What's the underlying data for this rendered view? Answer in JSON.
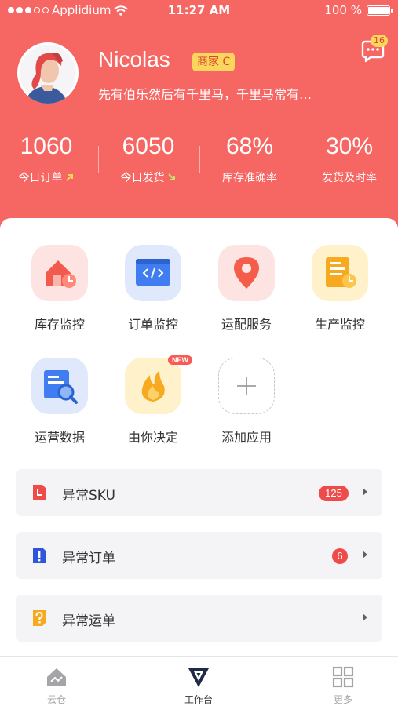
{
  "status_bar": {
    "carrier": "Applidium",
    "time": "11:27 AM",
    "battery": "100 %"
  },
  "profile": {
    "name": "Nicolas",
    "role_badge": "商家 C",
    "motto": "先有伯乐然后有千里马，千里马常有…",
    "message_count": "16"
  },
  "stats": [
    {
      "value": "1060",
      "label": "今日订单",
      "trend": "up",
      "trend_color": "#fbd65c"
    },
    {
      "value": "6050",
      "label": "今日发货",
      "trend": "down",
      "trend_color": "#c6e36b"
    },
    {
      "value": "68%",
      "label": "库存准确率",
      "trend": "",
      "trend_color": ""
    },
    {
      "value": "30%",
      "label": "发货及时率",
      "trend": "",
      "trend_color": ""
    }
  ],
  "apps": [
    {
      "label": "库存监控",
      "icon": "warehouse-icon"
    },
    {
      "label": "订单监控",
      "icon": "code-window-icon"
    },
    {
      "label": "运配服务",
      "icon": "location-pin-icon"
    },
    {
      "label": "生产监控",
      "icon": "production-report-icon"
    },
    {
      "label": "运营数据",
      "icon": "data-search-icon"
    },
    {
      "label": "由你决定",
      "icon": "flame-icon",
      "badge": "NEW"
    },
    {
      "label": "添加应用",
      "icon": "plus-icon"
    }
  ],
  "alerts": [
    {
      "label": "异常SKU",
      "count": "125",
      "icon": "sku-alert-icon"
    },
    {
      "label": "异常订单",
      "count": "6",
      "icon": "order-alert-icon"
    },
    {
      "label": "异常运单",
      "count": "",
      "icon": "waybill-alert-icon"
    }
  ],
  "tabs": [
    {
      "label": "云仓",
      "icon": "cloud-warehouse-icon",
      "active": false
    },
    {
      "label": "工作台",
      "icon": "workbench-icon",
      "active": true
    },
    {
      "label": "更多",
      "icon": "grid-icon",
      "active": false
    }
  ],
  "colors": {
    "header": "#f66663",
    "badge_yellow": "#fbd65c",
    "alert_red": "#ef4b4b"
  }
}
